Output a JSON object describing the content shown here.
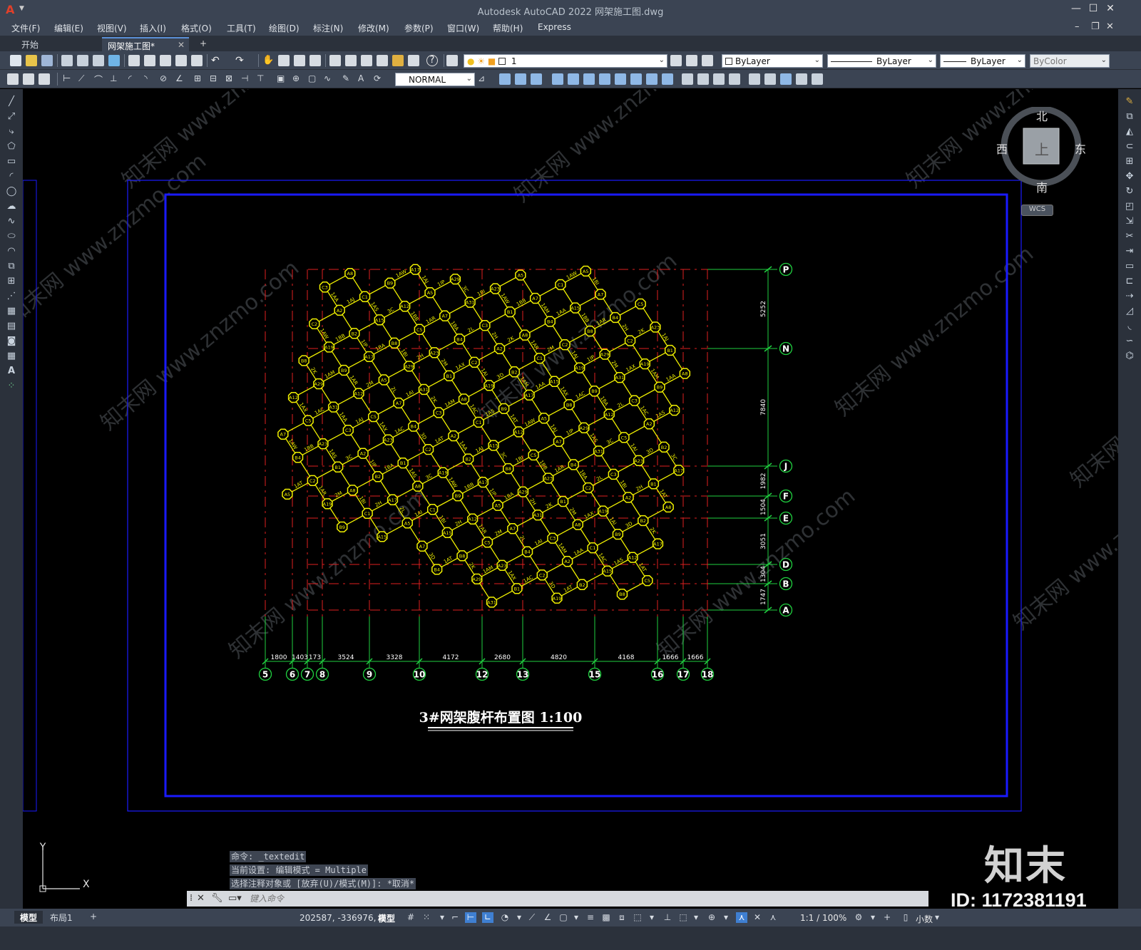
{
  "titlebar": {
    "app_logo": "A",
    "title": "Autodesk AutoCAD 2022    网架施工图.dwg",
    "minimize": "—",
    "maximize": "☐",
    "close": "✕"
  },
  "menubar": {
    "items": [
      "文件(F)",
      "编辑(E)",
      "视图(V)",
      "插入(I)",
      "格式(O)",
      "工具(T)",
      "绘图(D)",
      "标注(N)",
      "修改(M)",
      "参数(P)",
      "窗口(W)",
      "帮助(H)",
      "Express"
    ]
  },
  "tabs": {
    "start": "开始",
    "drawing": "网架施工图*",
    "new": "+"
  },
  "toolbar": {
    "layer_name": "1",
    "color": "ByLayer",
    "linetype": "ByLayer",
    "lineweight": "ByLayer",
    "plotstyle": "ByColor",
    "dimstyle": "NORMAL"
  },
  "viewcube": {
    "north": "北",
    "south": "南",
    "east": "东",
    "west": "西",
    "top": "上",
    "wcs": "WCS"
  },
  "drawing": {
    "title": "3#网架腹杆布置图  1:100",
    "row_axes": [
      "P",
      "N",
      "J",
      "F",
      "E",
      "D",
      "B",
      "A"
    ],
    "row_dims": [
      "5252",
      "7840",
      "1982",
      "1504",
      "3051",
      "1304",
      "1747"
    ],
    "col_axes": [
      "5",
      "6",
      "7",
      "8",
      "9",
      "10",
      "12",
      "13",
      "15",
      "16",
      "17",
      "18"
    ],
    "col_dims": [
      "1800",
      "1403",
      "173",
      "3524",
      "3328",
      "4172",
      "2680",
      "4820",
      "4168",
      "1666",
      "1666"
    ],
    "watermark": "知末网 www.znzmo.com"
  },
  "command": {
    "history": [
      "命令: _textedit",
      "当前设置: 编辑模式 = Multiple",
      "选择注释对象或 [放弃(U)/模式(M)]: *取消*"
    ],
    "placeholder": "键入命令"
  },
  "status": {
    "model_tab": "模型",
    "layout_tab": "布局1",
    "add_tab": "+",
    "coords": "202587, -336976, 0",
    "space": "模型",
    "scale": "1:1 / 100%",
    "units": "小数"
  },
  "branding": {
    "logo_text": "知末",
    "id_text": "ID: 1172381191"
  },
  "colors": {
    "grid_line": "#e02020",
    "axis_bubble": "#20d040",
    "node": "#f0f000",
    "frame": "#1a1aff",
    "accent": "#3f7fd1"
  }
}
